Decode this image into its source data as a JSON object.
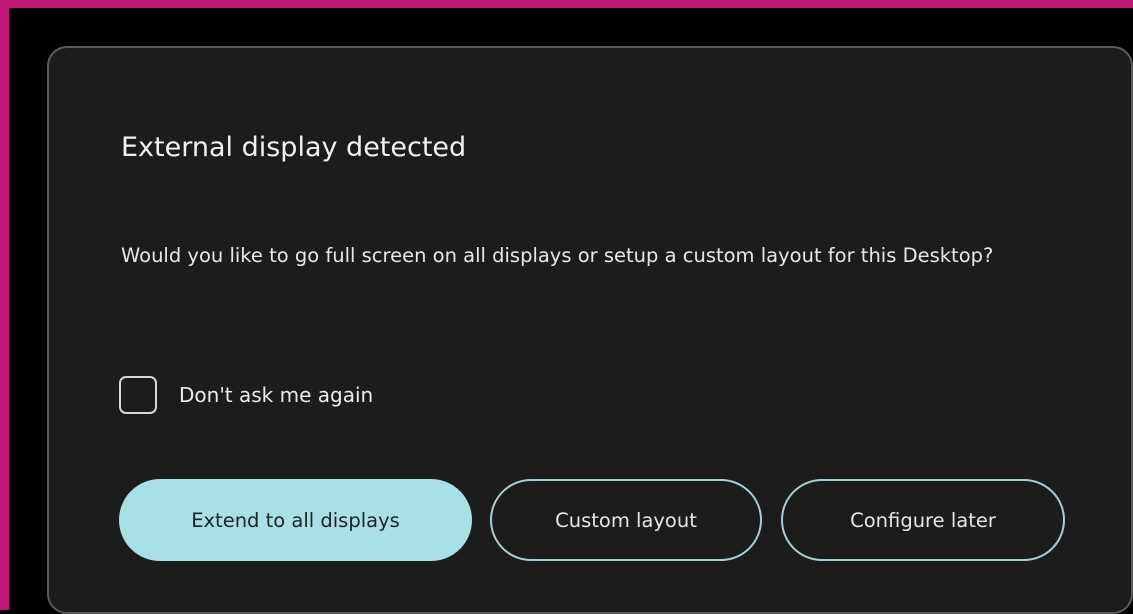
{
  "dialog": {
    "title": "External display detected",
    "message": "Would you like to go full screen on all displays or setup a custom layout for this Desktop?",
    "checkbox": {
      "label": "Don't ask me again",
      "checked": false
    },
    "buttons": {
      "extend": "Extend to all displays",
      "custom": "Custom layout",
      "later": "Configure later"
    }
  },
  "colors": {
    "frame_border": "#c2187a",
    "dialog_background": "#1c1c1c",
    "primary_button": "#a8e0e6",
    "outline_button_border": "#a3d2d6"
  }
}
